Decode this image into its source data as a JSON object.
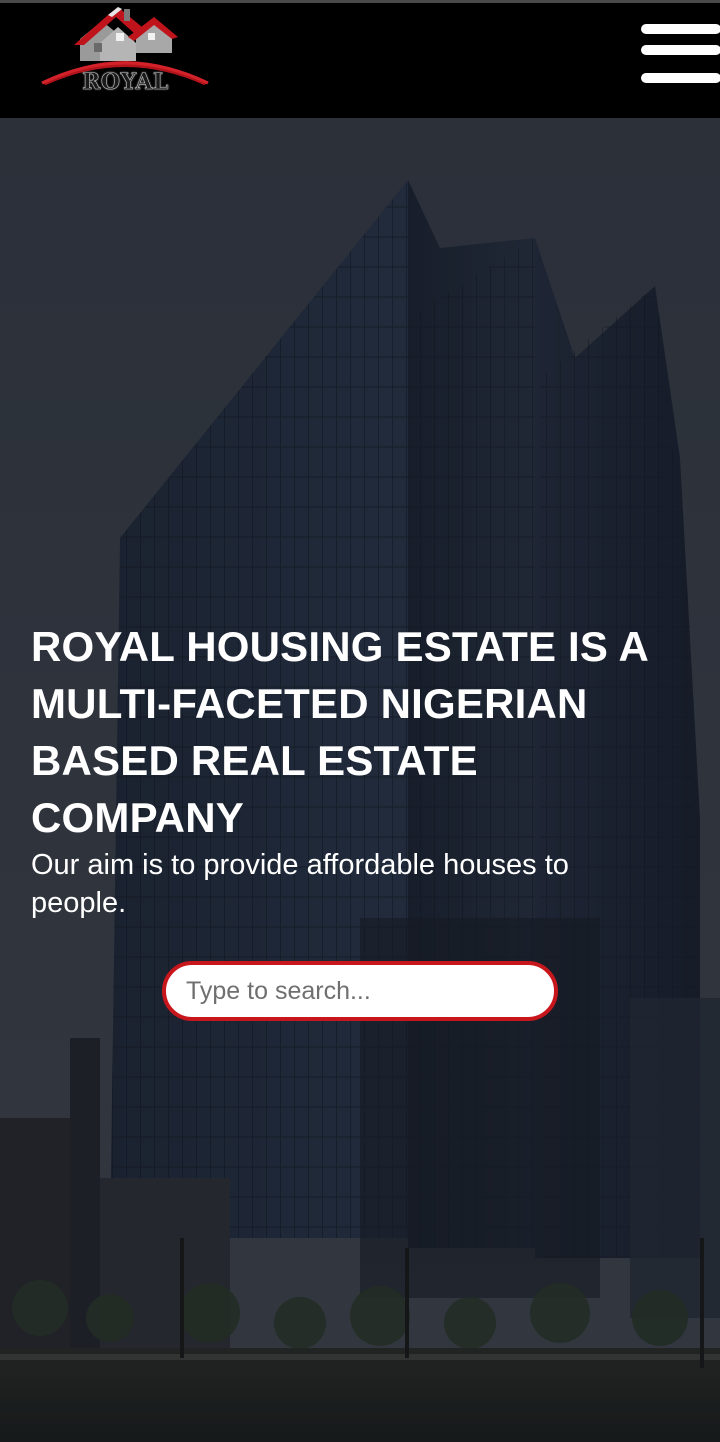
{
  "header": {
    "logo_text": "ROYAL",
    "logo_icon": "house-roof-logo-icon",
    "menu_icon": "hamburger-menu-icon"
  },
  "hero": {
    "headline": "ROYAL HOUSING ESTATE IS A MULTI-FACETED NIGERIAN BASED REAL ESTATE COMPANY",
    "subtitle": "Our aim is to provide affordable houses to people.",
    "background": "office-tower-photo"
  },
  "search": {
    "value": "",
    "placeholder": "Type to search..."
  },
  "colors": {
    "accent": "#c8161d",
    "header_bg": "#000000",
    "text": "#ffffff"
  }
}
